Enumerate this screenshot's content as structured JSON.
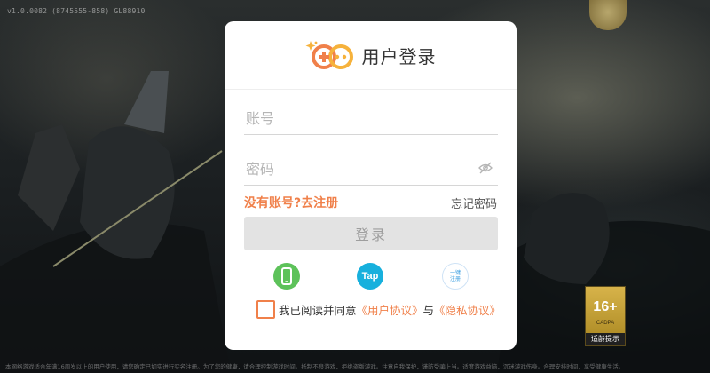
{
  "background": {
    "version_text": "v1.0.0082 (8745555-858) GL88910",
    "footer_notice": "本网络游戏适合年满16周岁以上的用户使用，请您确定已如实进行实名注册。为了您的健康，请合理控制游戏时间。抵制不良游戏，拒绝盗版游戏。注意自我保护，谨防受骗上当。适度游戏益脑，沉迷游戏伤身。合理安排时间，享受健康生活。",
    "age_badge": {
      "rating": "16+",
      "org": "CADPA",
      "label": "适龄提示"
    }
  },
  "dialog": {
    "title": "用户登录",
    "account_placeholder": "账号",
    "password_placeholder": "密码",
    "register_link": "没有账号?去注册",
    "forgot_link": "忘记密码",
    "login_button": "登录",
    "alt_login": {
      "tap_label": "Tap",
      "quick_line1": "一键",
      "quick_line2": "注册"
    },
    "agreement": {
      "prefix": "我已阅读并同意",
      "user_agreement": "《用户协议》",
      "conjunction": "与",
      "privacy_policy": "《隐私协议》"
    }
  },
  "colors": {
    "accent": "#f0804a",
    "button_disabled": "#e3e3e3",
    "phone_green": "#5dc25a",
    "tap_blue": "#17b0dd"
  }
}
